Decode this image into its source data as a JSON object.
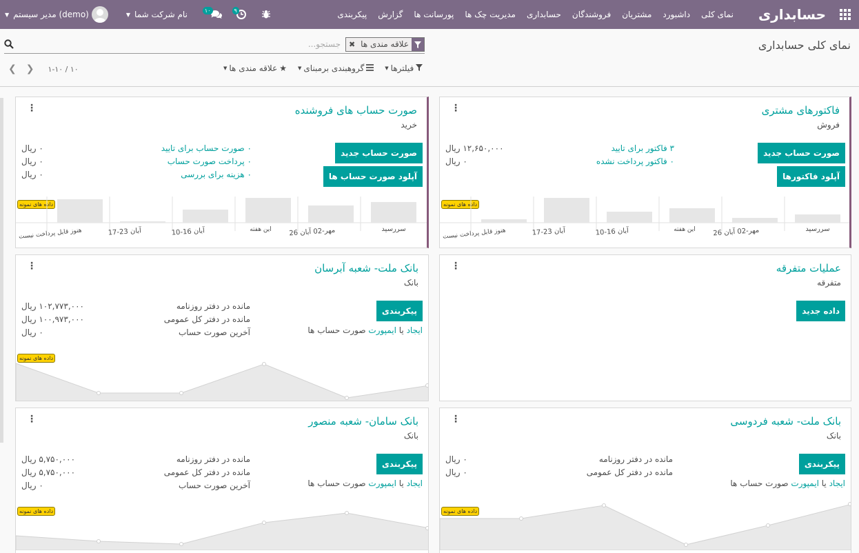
{
  "navbar": {
    "brand": "حسابداری",
    "menu": [
      "نمای کلی",
      "داشبورد",
      "مشتریان",
      "فروشندگان",
      "حسابداری",
      "مدیریت چک ها",
      "پورسانت ها",
      "گزارش",
      "پیکربندی"
    ],
    "company": "نام شرکت شما",
    "user": "مدیر سیستم (demo)",
    "messages_count": "۱۰",
    "activities_count": "۹",
    "colors": {
      "bar": "#7c6a87",
      "accent": "#00a09d"
    }
  },
  "control_panel": {
    "title": "نمای کلی حسابداری",
    "facet_label": "علاقه مندی ها",
    "search_placeholder": "جستجو...",
    "filters": "فیلترها",
    "groupby": "گروهبندی برمبنای",
    "favorites": "علاقه مندی ها",
    "pager_value": "۱-۱۰ / ۱۰"
  },
  "sample_badge": "داده های نمونه",
  "cards": {
    "sales": {
      "title": "فاکتورهای مشتری",
      "subtitle": "فروش",
      "btn1": "صورت حساب جدید",
      "btn2": "آپلود فاکتورها",
      "stats": [
        {
          "label": "۳ فاکتور برای تایید",
          "value": "۱۲,۶۵۰,۰۰۰ ریال"
        },
        {
          "label": "۰ فاکتور پرداخت نشده",
          "value": "۰ ریال"
        }
      ],
      "chart_labels": [
        "سررسید",
        "26 مهر-02 آبان",
        "این هفته",
        "10-16 آبان",
        "17-23 آبان",
        "هنوز قابل پرداخت نیست"
      ]
    },
    "purchase": {
      "title": "صورت حساب های فروشنده",
      "subtitle": "خرید",
      "btn1": "صورت حساب جدید",
      "btn2": "آپلود صورت حساب ها",
      "stats": [
        {
          "label": "۰ صورت حساب برای تایید",
          "value": "۰ ریال"
        },
        {
          "label": "۰ پرداخت صورت حساب",
          "value": "۰ ریال"
        },
        {
          "label": "۰ هزینه برای بررسی",
          "value": "۰ ریال"
        }
      ],
      "chart_labels": [
        "سررسید",
        "26 مهر-02 آبان",
        "این هفته",
        "10-16 آبان",
        "17-23 آبان",
        "هنوز قابل پرداخت نیست"
      ]
    },
    "misc": {
      "title": "عملیات متفرقه",
      "subtitle": "متفرقه",
      "btn1": "داده جدید"
    },
    "bank_abresan": {
      "title": "بانک ملت- شعبه آبرسان",
      "subtitle": "بانک",
      "btn1": "پیکربندی",
      "import_create": "ایجاد",
      "import_or": "یا",
      "import_link": "ایمپورت",
      "import_rest": "صورت حساب ها",
      "stats": [
        {
          "label": "مانده در دفتر روزنامه",
          "value": "۱۰۲,۷۷۳,۰۰۰ ریال"
        },
        {
          "label": "مانده در دفتر کل عمومی",
          "value": "۱۰۰,۹۷۳,۰۰۰ ریال"
        },
        {
          "label": "آخرین صورت حساب",
          "value": "۰ ریال"
        }
      ]
    },
    "bank_ferdowsi": {
      "title": "بانک ملت- شعبه فردوسی",
      "subtitle": "بانک",
      "btn1": "پیکربندی",
      "import_create": "ایجاد",
      "import_or": "یا",
      "import_link": "ایمپورت",
      "import_rest": "صورت حساب ها",
      "stats": [
        {
          "label": "مانده در دفتر روزنامه",
          "value": "۰ ریال"
        },
        {
          "label": "مانده در دفتر کل عمومی",
          "value": "۰ ریال"
        }
      ]
    },
    "bank_saman": {
      "title": "بانک سامان- شعبه منصور",
      "subtitle": "بانک",
      "btn1": "پیکربندی",
      "import_create": "ایجاد",
      "import_or": "یا",
      "import_link": "ایمپورت",
      "import_rest": "صورت حساب ها",
      "stats": [
        {
          "label": "مانده در دفتر روزنامه",
          "value": "۵,۷۵۰,۰۰۰ ریال"
        },
        {
          "label": "مانده در دفتر کل عمومی",
          "value": "۵,۷۵۰,۰۰۰ ریال"
        },
        {
          "label": "آخرین صورت حساب",
          "value": "۰ ریال"
        }
      ]
    }
  }
}
